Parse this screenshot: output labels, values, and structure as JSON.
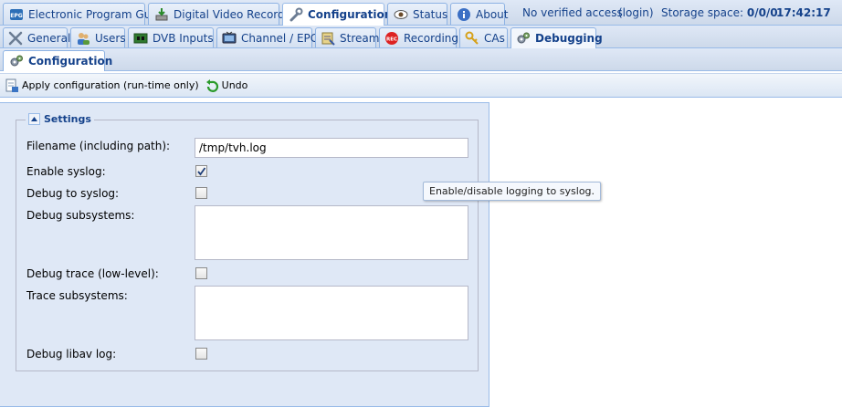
{
  "main_tabs": [
    {
      "label": "Electronic Program Guide",
      "icon": "epg-icon"
    },
    {
      "label": "Digital Video Recorder",
      "icon": "dvr-icon"
    },
    {
      "label": "Configuration",
      "icon": "wrench-icon",
      "active": true
    },
    {
      "label": "Status",
      "icon": "eye-icon"
    },
    {
      "label": "About",
      "icon": "info-icon"
    }
  ],
  "header_info": {
    "access": "No verified access",
    "login": "(login)",
    "storage_label": "Storage space:",
    "storage_value": "0/0/0",
    "time": "17:42:17"
  },
  "config_tabs": [
    {
      "label": "General",
      "icon": "tools-icon"
    },
    {
      "label": "Users",
      "icon": "users-icon"
    },
    {
      "label": "DVB Inputs",
      "icon": "dvb-card-icon"
    },
    {
      "label": "Channel / EPG",
      "icon": "tv-icon"
    },
    {
      "label": "Stream",
      "icon": "stream-icon"
    },
    {
      "label": "Recording",
      "icon": "rec-icon"
    },
    {
      "label": "CAs",
      "icon": "key-icon"
    },
    {
      "label": "Debugging",
      "icon": "gears-icon",
      "active": true
    }
  ],
  "third_tab": {
    "label": "Configuration",
    "icon": "gears-icon"
  },
  "toolbar": {
    "apply_label": "Apply configuration (run-time only)",
    "undo_label": "Undo"
  },
  "settings": {
    "legend": "Settings",
    "filename_label": "Filename (including path):",
    "filename_value": "/tmp/tvh.log",
    "enable_syslog_label": "Enable syslog:",
    "enable_syslog_checked": true,
    "debug_syslog_label": "Debug to syslog:",
    "debug_syslog_checked": false,
    "debug_subsystems_label": "Debug subsystems:",
    "debug_subsystems_value": "",
    "debug_trace_label": "Debug trace (low-level):",
    "debug_trace_checked": false,
    "trace_subsystems_label": "Trace subsystems:",
    "trace_subsystems_value": "",
    "debug_libav_label": "Debug libav log:",
    "debug_libav_checked": false
  },
  "tooltip": "Enable/disable logging to syslog.",
  "colors": {
    "panel_bg": "#dfe8f6",
    "border": "#99bbe8",
    "text": "#15428b"
  }
}
